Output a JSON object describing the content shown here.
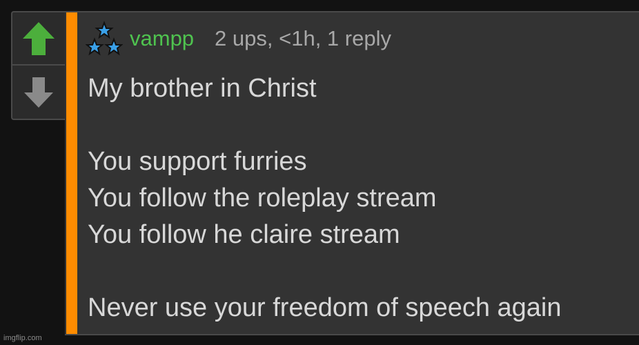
{
  "comment": {
    "username": "vampp",
    "meta": "2 ups, <1h, 1 reply",
    "lines": [
      "My brother in Christ",
      "You support furries",
      "You follow the roleplay stream",
      "You follow he claire stream",
      "Never use your freedom of speech again"
    ]
  },
  "watermark": "imgflip.com",
  "colors": {
    "accent": "#ff8c00",
    "username": "#4fc34f",
    "upvote": "#4caf3c",
    "downvote": "#8a8a8a",
    "star": "#3aa0e8"
  },
  "icons": {
    "upvote": "arrow-up-icon",
    "downvote": "arrow-down-icon",
    "badge": "star-badge-icon"
  }
}
